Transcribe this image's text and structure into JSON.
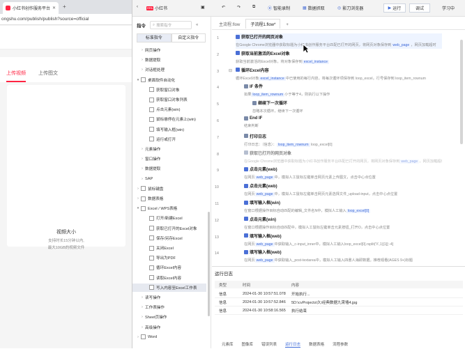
{
  "browser": {
    "tab_title": "小红书创作服务平台",
    "url": "ongshu.com/publish/publish?source=official",
    "upload_tabs": [
      "上传视频",
      "上传图文"
    ],
    "drop_title": "视频大小",
    "drop_sub1": "支持时长15分钟以内,",
    "drop_sub2": "最大10GB的视频文件"
  },
  "topbar": {
    "app_name": "小红书",
    "smart_record": "智能录制",
    "data_capture": "数据抓取",
    "shadow_browser": "影刀浏览器",
    "run": "运行",
    "debug": "调试",
    "learn": "学习中"
  },
  "command_panel": {
    "title": "指令",
    "search_placeholder": "搜索指令",
    "tabs": [
      "标准指令",
      "自定义指令"
    ],
    "items": [
      {
        "label": "网页操作",
        "indent": 1,
        "caret": "right",
        "icon": false
      },
      {
        "label": "数据提取",
        "indent": 1,
        "caret": "right",
        "icon": false
      },
      {
        "label": "对话框处理",
        "indent": 1,
        "caret": "right",
        "icon": false
      },
      {
        "label": "桌面软件自动化",
        "indent": 0,
        "caret": "down",
        "icon": true
      },
      {
        "label": "获取窗口对象",
        "indent": 2,
        "caret": "",
        "icon": true
      },
      {
        "label": "获取窗口对象列表",
        "indent": 2,
        "caret": "",
        "icon": true
      },
      {
        "label": "点击元素(win)",
        "indent": 2,
        "caret": "",
        "icon": true
      },
      {
        "label": "鼠标悬停在元素上(win)",
        "indent": 2,
        "caret": "",
        "icon": true
      },
      {
        "label": "填写输入框(win)",
        "indent": 2,
        "caret": "",
        "icon": true
      },
      {
        "label": "运行或打开",
        "indent": 2,
        "caret": "",
        "icon": true
      },
      {
        "label": "元素操作",
        "indent": 1,
        "caret": "right",
        "icon": false
      },
      {
        "label": "窗口操作",
        "indent": 1,
        "caret": "right",
        "icon": false
      },
      {
        "label": "数据提取",
        "indent": 1,
        "caret": "right",
        "icon": false
      },
      {
        "label": "SAP",
        "indent": 1,
        "caret": "right",
        "icon": false
      },
      {
        "label": "鼠标键盘",
        "indent": 0,
        "caret": "right",
        "icon": true
      },
      {
        "label": "数据表格",
        "indent": 0,
        "caret": "right",
        "icon": true
      },
      {
        "label": "Excel / WPS表格",
        "indent": 0,
        "caret": "down",
        "icon": true
      },
      {
        "label": "打开/新建Excel",
        "indent": 2,
        "caret": "",
        "icon": true
      },
      {
        "label": "获取已打开的Excel对象",
        "indent": 2,
        "caret": "",
        "icon": true
      },
      {
        "label": "保存/另存Excel",
        "indent": 2,
        "caret": "",
        "icon": true
      },
      {
        "label": "关闭Excel",
        "indent": 2,
        "caret": "",
        "icon": true
      },
      {
        "label": "导出为PDF",
        "indent": 2,
        "caret": "",
        "icon": true
      },
      {
        "label": "循环Excel内容",
        "indent": 2,
        "caret": "",
        "icon": true
      },
      {
        "label": "读取Excel内容",
        "indent": 2,
        "caret": "",
        "icon": true
      },
      {
        "label": "写入内容至Excel工作表",
        "indent": 2,
        "caret": "",
        "icon": true,
        "selected": true
      },
      {
        "label": "读写操作",
        "indent": 1,
        "caret": "right",
        "icon": false
      },
      {
        "label": "工作表操作",
        "indent": 1,
        "caret": "right",
        "icon": false
      },
      {
        "label": "Sheet页操作",
        "indent": 1,
        "caret": "right",
        "icon": false
      },
      {
        "label": "高级操作",
        "indent": 1,
        "caret": "right",
        "icon": false
      },
      {
        "label": "Word",
        "indent": 0,
        "caret": "right",
        "icon": true
      }
    ]
  },
  "editor": {
    "tabs": [
      "主流程.flow",
      "子流程1.flow*",
      "+"
    ],
    "steps": [
      {
        "ln": "1",
        "indent": 0,
        "title": "获取已打开的网页对象",
        "desc": "在Google Chrome浏览器中获取标题为小红书创作服务平台匹配已打开的网页，将网页对象保存到",
        "chip": "web_page",
        "desc2": "，网页加载超时",
        "icon": "blue",
        "hl": true
      },
      {
        "ln": "2",
        "indent": 0,
        "title": "获取当前激活的Excel对象",
        "desc": "获取当前激活的Excel对象，将对象保存到",
        "chip": "excel_instance",
        "desc2": "",
        "icon": "blue"
      },
      {
        "ln": "3",
        "indent": 0,
        "title": "循环Excel内容",
        "desc": "循环Excel对象",
        "chip": "excel_instance",
        "desc2": "中已使用的每行内容，将每次循环项保存到 loop_excel，行号保存到 loop_item_rownum",
        "icon": "blue"
      },
      {
        "ln": "4",
        "indent": 1,
        "title": "IF 条件",
        "desc": "如果",
        "chip": "loop_item_rownum",
        "desc2": "小于等于4，则执行以下操作",
        "icon": "gray"
      },
      {
        "ln": "5",
        "indent": 2,
        "title": "继续下一次循环",
        "desc": "忽略本次循环，继续下一次循环",
        "chip": "",
        "desc2": "",
        "icon": "gray"
      },
      {
        "ln": "6",
        "indent": 1,
        "title": "End IF",
        "desc": "结束判断",
        "chip": "",
        "desc2": "",
        "icon": "gray"
      },
      {
        "ln": "7",
        "indent": 1,
        "title": "打印日志",
        "desc": "打印日志：（信息）：",
        "chip": "loop_item_rownum",
        "desc2": " loop_excel[0]",
        "icon": "gray"
      },
      {
        "ln": "8",
        "indent": 1,
        "title": "获取已打开的网页对象",
        "desc": "在Google Chrome浏览器中获取标题为小红书创作服务平台匹配已打开的网页，将网页对象保存到",
        "chip": "web_page",
        "desc2": "，网页加载超时",
        "icon": "gray",
        "dim": true
      },
      {
        "ln": "9",
        "indent": 1,
        "title": "点击元素(web)",
        "desc": "在网页",
        "chip": "web_page",
        "desc2": "中，模拟人工鼠标左键单击网页元素上传图文，点击中心点位置",
        "icon": "blue"
      },
      {
        "ln": "10",
        "indent": 1,
        "title": "点击元素(web)",
        "desc": "在网页",
        "chip": "web_page",
        "desc2": "中，模拟人工鼠标左键单击网页元素选择文件_upload-input，点击中心点位置",
        "icon": "blue"
      },
      {
        "ln": "11",
        "indent": 1,
        "title": "填写输入框(win)",
        "desc": "在窗口根据操作目标自动匹配的编辑_文件名N中，模拟人工输入",
        "chip": "loop_excel[0]",
        "desc2": "",
        "icon": "blue"
      },
      {
        "ln": "12",
        "indent": 1,
        "title": "点击元素(win)",
        "desc": "在窗口根据操作目标自动匹配中，模拟人工鼠标左键单击元素按钮_打开O，点击中心点位置",
        "chip": "",
        "desc2": "",
        "icon": "blue"
      },
      {
        "ln": "13",
        "indent": 1,
        "title": "填写输入框(web)",
        "desc": "在网页",
        "chip": "web_page",
        "desc2": "中获取输入_c-input_inner中，模拟人工输入loop_excel[0].rsplit('\\\\',1)[1][:-4]",
        "icon": "blue"
      },
      {
        "ln": "14",
        "indent": 1,
        "title": "填写输入框(web)",
        "desc": "在网页",
        "chip": "web_page",
        "desc2": "中获取输入_post-textarea中，模拟人工输入四書人海即数据。推荐观看(AGES 9+)标题",
        "icon": "blue"
      }
    ]
  },
  "log": {
    "title": "运行日志",
    "headers": [
      "类型",
      "时间",
      "内容"
    ],
    "rows": [
      [
        "信息",
        "2024-01-30 10:57:51.078",
        "开始执行..."
      ],
      [
        "信息",
        "2024-01-30 10:57:52.846",
        "5D:\\cvProjects\\久\\经典数据九霄墙4.jpg"
      ],
      [
        "信息",
        "2024-01-30 10:58:16.565",
        "执行结束"
      ]
    ],
    "tabs": [
      "元素库",
      "图像库",
      "错误列表",
      "运行日志",
      "数据表格",
      "流程参数"
    ],
    "active_tab": "运行日志"
  }
}
